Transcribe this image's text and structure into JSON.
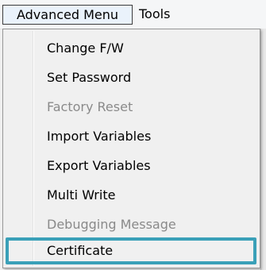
{
  "menubar": {
    "advanced_label": "Advanced Menu",
    "tools_label": "Tools"
  },
  "dropdown": {
    "items": [
      {
        "label": "Change F/W",
        "enabled": true
      },
      {
        "label": "Set Password",
        "enabled": true
      },
      {
        "label": "Factory Reset",
        "enabled": false
      },
      {
        "label": "Import Variables",
        "enabled": true
      },
      {
        "label": "Export Variables",
        "enabled": true
      },
      {
        "label": "Multi Write",
        "enabled": true
      },
      {
        "label": "Debugging Message",
        "enabled": false
      },
      {
        "label": "Certificate",
        "enabled": true,
        "highlighted": true
      }
    ]
  },
  "colors": {
    "highlight_border": "#3aa0b8",
    "disabled_text": "#8a8a8a"
  }
}
